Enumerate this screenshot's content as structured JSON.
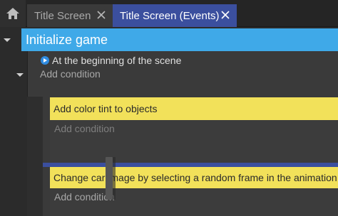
{
  "tabs": [
    {
      "label": "Title Screen",
      "active": false
    },
    {
      "label": "Title Screen (Events)",
      "active": true
    }
  ],
  "colors": {
    "accent": "#3b4f9e",
    "event_header": "#3fa9e8",
    "action": "#f2e15a"
  },
  "icons": {
    "home": "home-icon",
    "close": "close-icon",
    "collapse": "chevron-down-icon",
    "condition": "play-circle-icon"
  },
  "event": {
    "title": "Initialize game",
    "condition": "At the beginning of the scene",
    "add_condition": "Add condition"
  },
  "subevents": [
    {
      "action": "Add color tint to objects",
      "add_condition": "Add condition"
    },
    {
      "action": "Change car image by selecting a random frame in the animation",
      "add_condition": "Add condition"
    }
  ]
}
